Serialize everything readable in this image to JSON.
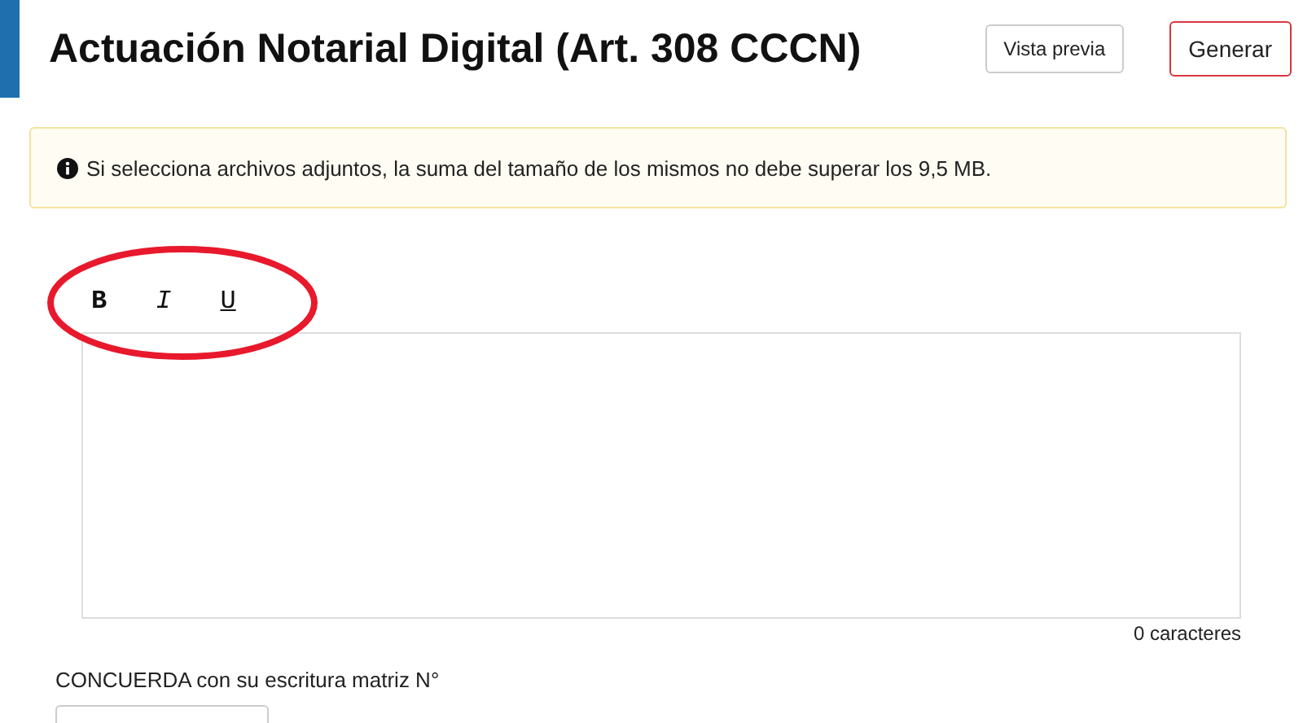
{
  "header": {
    "title": "Actuación Notarial Digital (Art. 308 CCCN)",
    "buttons": [
      {
        "label": "Vista previa",
        "kind": "secondary"
      },
      {
        "label": "Generar",
        "kind": "primary"
      }
    ]
  },
  "notice": {
    "text": "Si selecciona archivos adjuntos, la suma del tamaño de los mismos no debe superar los 9,5 MB."
  },
  "toolbar": [
    {
      "label": "B",
      "kind": "bold"
    },
    {
      "label": "I",
      "kind": "italic"
    },
    {
      "label": "U",
      "kind": "underline"
    }
  ],
  "editor": {
    "counter": "0 caracteres"
  },
  "matrix_field": {
    "label": "CONCUERDA con su escritura matriz N°"
  }
}
